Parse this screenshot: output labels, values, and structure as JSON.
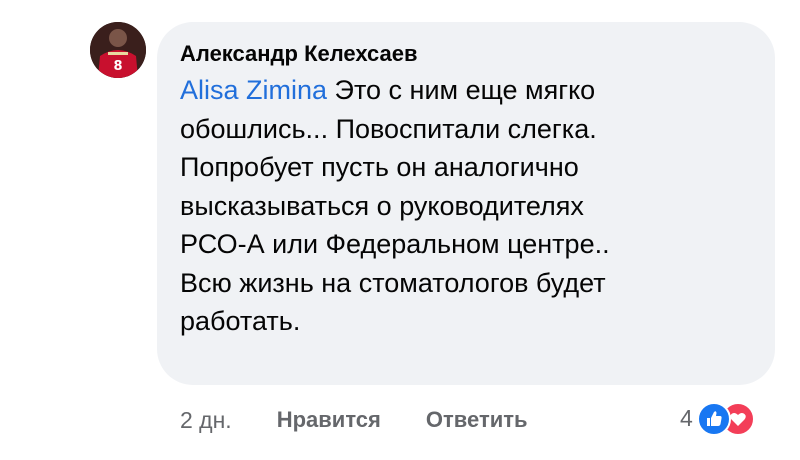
{
  "comment": {
    "author": "Александр Келехсаев",
    "mention": "Alisa Zimina",
    "text_lines": [
      " Это с ним еще мягко",
      "обошлись... Повоспитали слегка.",
      "Попробует пусть он аналогично",
      "высказываться о руководителях",
      "РСО-А или Федеральном центре..",
      "Всю жизнь на стоматологов будет",
      "работать."
    ]
  },
  "actions": {
    "time": "2 дн.",
    "like_label": "Нравится",
    "reply_label": "Ответить"
  },
  "reactions": {
    "count": "4",
    "icons": [
      "like-icon",
      "love-icon"
    ]
  },
  "colors": {
    "bubble_bg": "#f0f2f5",
    "mention": "#216fdb",
    "secondary_text": "#65676b",
    "like": "#1877f2",
    "love": "#f33e58"
  }
}
